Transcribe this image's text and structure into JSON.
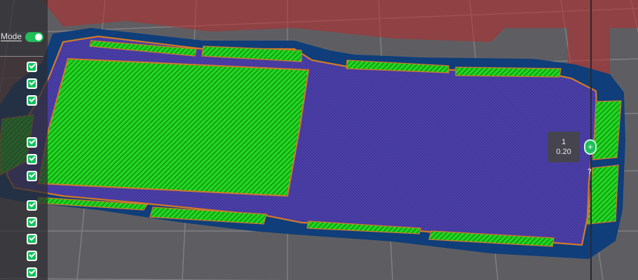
{
  "viewport": {
    "background_color": "#5e5e62",
    "colors": {
      "travel": "#b92b2b",
      "support_brim": "#0f3e7a",
      "solid_fill": "#4a3fa5",
      "outer_wall": "#d07a2a",
      "infill": "#1bd21b"
    }
  },
  "left_panel": {
    "mode_label": "Mode",
    "mode_toggle_on": true,
    "checkboxes": [
      true,
      true,
      true,
      true,
      true,
      true,
      true,
      true,
      true,
      true,
      true
    ]
  },
  "layer_slider": {
    "layer_number": "1",
    "layer_height": "0.20",
    "handle_icon": "plus-icon",
    "handle_glyph": "+",
    "help_glyph": "?"
  }
}
